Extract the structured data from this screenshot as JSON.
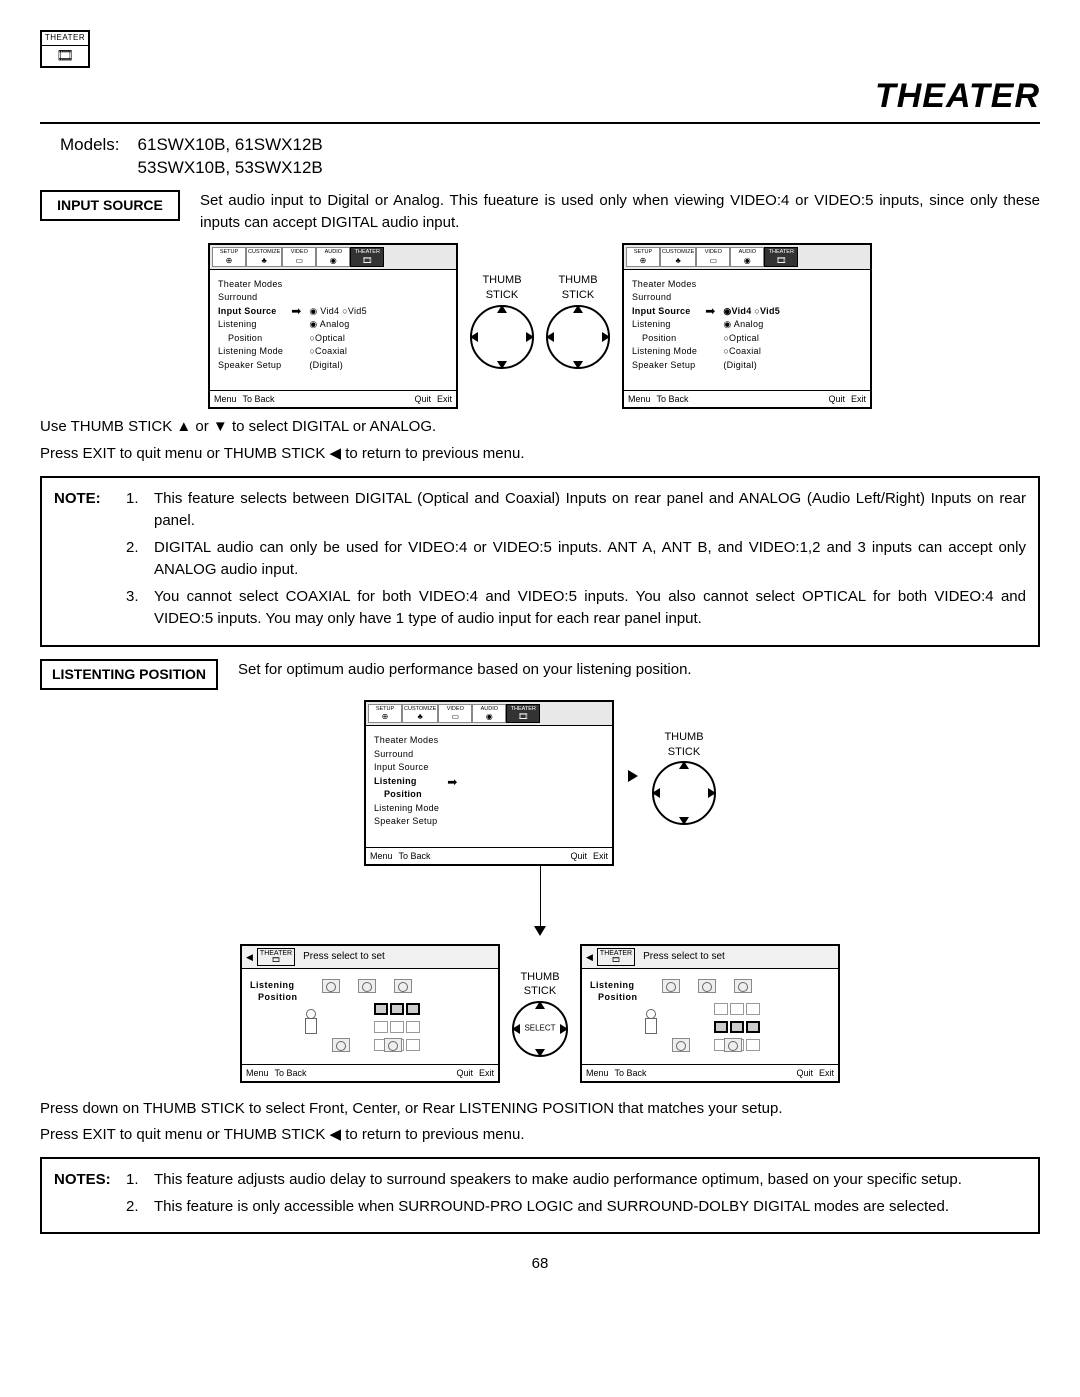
{
  "badge": {
    "label": "THEATER"
  },
  "page_title": "THEATER",
  "models": {
    "label": "Models:",
    "line1": "61SWX10B, 61SWX12B",
    "line2": "53SWX10B, 53SWX12B"
  },
  "input_source": {
    "label": "INPUT SOURCE",
    "desc": "Set audio input to Digital or Analog.  This fueature is used only when viewing VIDEO:4 or VIDEO:5 inputs, since only these inputs can accept DIGITAL audio input.",
    "thumb_label": "THUMB\nSTICK",
    "osd_tabs": [
      "SETUP",
      "CUSTOMIZE",
      "VIDEO",
      "AUDIO",
      "THEATER"
    ],
    "osd_left_menu": {
      "items": [
        {
          "t": "Theater Modes",
          "b": false
        },
        {
          "t": "Surround",
          "b": false
        },
        {
          "t": "Input Source",
          "b": true
        },
        {
          "t": "Listening",
          "b": false
        },
        {
          "t": "  Position",
          "b": false,
          "indent": true
        },
        {
          "t": "Listening Mode",
          "b": false
        },
        {
          "t": "Speaker Setup",
          "b": false
        }
      ]
    },
    "osd_right_a": [
      "◉ Vid4  ○Vid5",
      "◉ Analog",
      "○Optical",
      "○Coaxial",
      "  (Digital)"
    ],
    "osd_right_b": [
      "◉Vid4  ○Vid5",
      "◉ Analog",
      "○Optical",
      "○Coaxial",
      "  (Digital)"
    ],
    "osd_foot": {
      "a": "Menu",
      "b": "To Back",
      "c": "Quit",
      "d": "Exit"
    },
    "instr1": "Use THUMB STICK ▲ or ▼ to select DIGITAL or ANALOG.",
    "instr2": "Press EXIT to quit menu or THUMB STICK ◀ to return to previous menu.",
    "note": {
      "tag": "NOTE:",
      "items": [
        "This feature selects between DIGITAL (Optical and Coaxial) Inputs on rear panel and ANALOG (Audio Left/Right) Inputs on rear panel.",
        "DIGITAL audio can only be used for VIDEO:4 or VIDEO:5 inputs.  ANT A, ANT B, and VIDEO:1,2 and 3 inputs can accept only ANALOG audio input.",
        "You cannot select COAXIAL for both VIDEO:4 and VIDEO:5 inputs.  You also cannot select OPTICAL for both VIDEO:4 and VIDEO:5 inputs.  You may only have 1 type of audio input for each rear panel input."
      ]
    }
  },
  "listening": {
    "label": "LISTENTING POSITION",
    "desc": "Set for optimum audio performance based on your listening position.",
    "thumb_label": "THUMB\nSTICK",
    "select_label": "SELECT",
    "pos_head": "Press select to set",
    "pos_head_icon_label": "THEATER",
    "pos_menu_a": "Listening",
    "pos_menu_b": "Position",
    "instr1": "Press down on THUMB STICK to select Front, Center, or Rear LISTENING POSITION that matches your setup.",
    "instr2": "Press EXIT to quit menu or THUMB STICK ◀ to return to previous menu.",
    "notes": {
      "tag": "NOTES:",
      "items": [
        "This feature adjusts audio delay to surround speakers to make audio performance optimum, based on your specific setup.",
        "This feature is only accessible when SURROUND-PRO LOGIC and SURROUND-DOLBY DIGITAL modes are selected."
      ]
    }
  },
  "page_number": "68"
}
